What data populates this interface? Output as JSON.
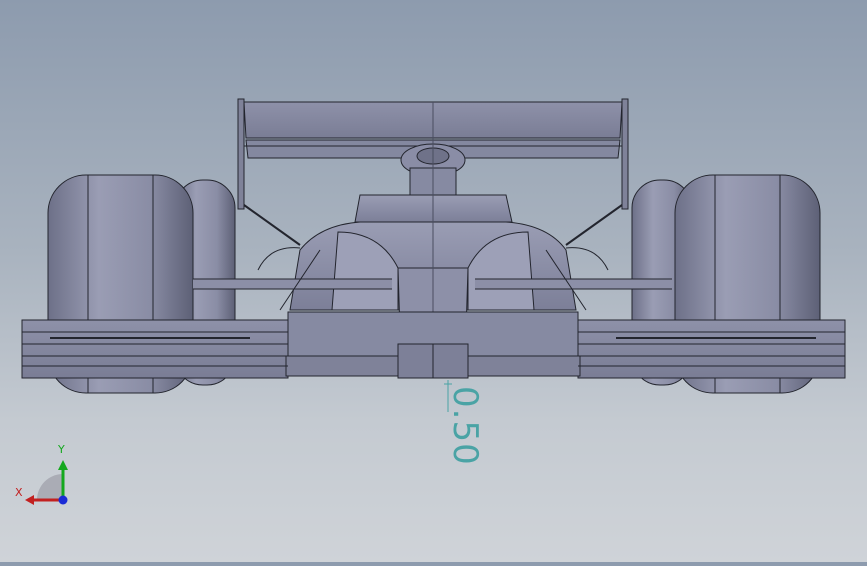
{
  "viewport": {
    "background_top": "#8d9bae",
    "background_bottom": "#cfd3d8",
    "model_color": "#8a8ea8",
    "edge_color": "#23252e"
  },
  "dimension": {
    "value": "0.50",
    "color": "#4aa3a5"
  },
  "triad": {
    "x_label": "X",
    "y_label": "Y",
    "x_color": "#c22020",
    "y_color": "#14a81e",
    "z_color": "#1a2bd6"
  }
}
